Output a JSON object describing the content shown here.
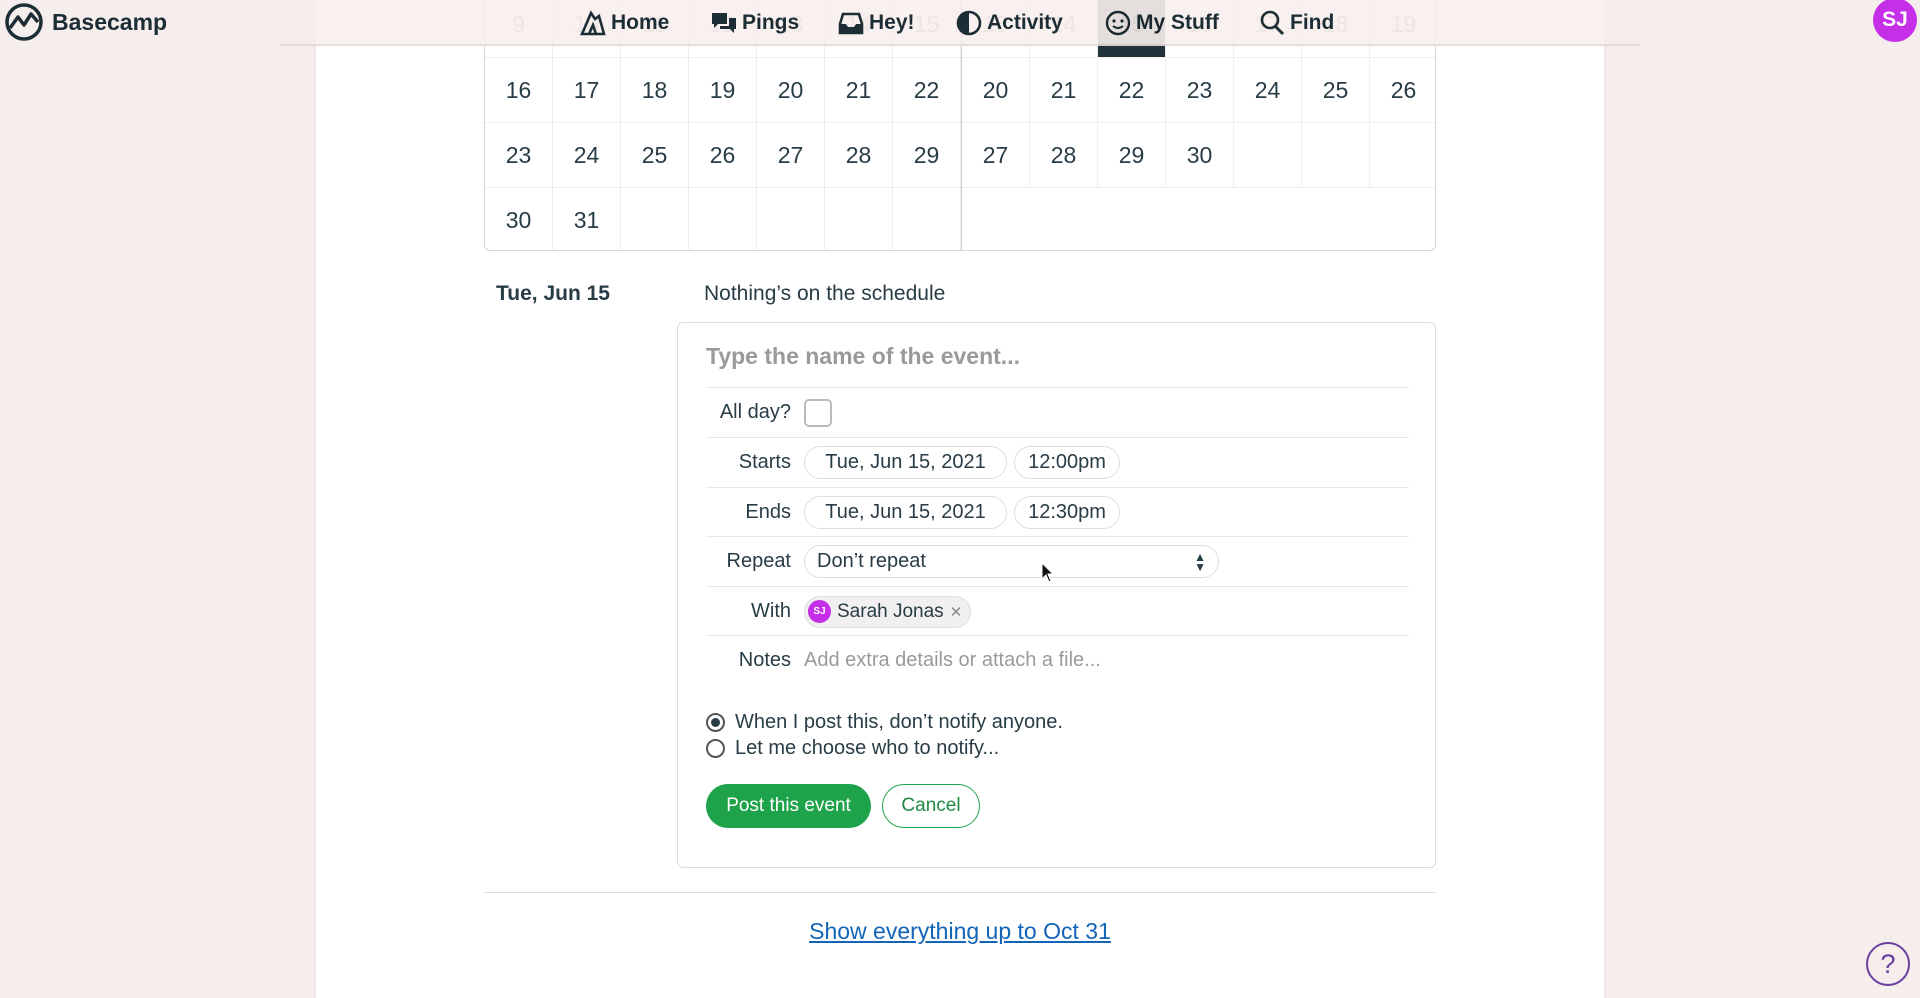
{
  "nav": {
    "logo": "Basecamp",
    "items": [
      {
        "label": "Home",
        "icon": "home-icon"
      },
      {
        "label": "Pings",
        "icon": "pings-icon"
      },
      {
        "label": "Hey!",
        "icon": "hey-icon"
      },
      {
        "label": "Activity",
        "icon": "activity-icon"
      },
      {
        "label": "My Stuff",
        "icon": "smiley-icon"
      },
      {
        "label": "Find",
        "icon": "search-icon"
      }
    ],
    "avatar": "SJ"
  },
  "calendar": {
    "left_rows": [
      [
        "9",
        "10",
        "11",
        "12",
        "13",
        "14",
        "15"
      ],
      [
        "16",
        "17",
        "18",
        "19",
        "20",
        "21",
        "22"
      ],
      [
        "23",
        "24",
        "25",
        "26",
        "27",
        "28",
        "29"
      ],
      [
        "30",
        "31",
        "",
        "",
        "",
        "",
        ""
      ]
    ],
    "right_rows": [
      [
        "13",
        "14",
        "15",
        "16",
        "17",
        "18",
        "19"
      ],
      [
        "20",
        "21",
        "22",
        "23",
        "24",
        "25",
        "26"
      ],
      [
        "27",
        "28",
        "29",
        "30",
        "",
        "",
        ""
      ],
      [
        "",
        "",
        "",
        "",
        "",
        "",
        ""
      ]
    ]
  },
  "day": {
    "label": "Tue, Jun 15",
    "empty": "Nothing’s on the schedule"
  },
  "form": {
    "title_placeholder": "Type the name of the event...",
    "allday_label": "All day?",
    "starts_label": "Starts",
    "start_date": "Tue, Jun 15, 2021",
    "start_time": "12:00pm",
    "ends_label": "Ends",
    "end_date": "Tue, Jun 15, 2021",
    "end_time": "12:30pm",
    "repeat_label": "Repeat",
    "repeat_value": "Don’t repeat",
    "with_label": "With",
    "with_person": "Sarah Jonas",
    "with_initials": "SJ",
    "notes_label": "Notes",
    "notes_placeholder": "Add extra details or attach a file...",
    "radio1": "When I post this, don’t notify anyone.",
    "radio2": "Let me choose who to notify...",
    "post": "Post this event",
    "cancel": "Cancel"
  },
  "show_link": "Show everything up to Oct 31",
  "help": "?",
  "colors": {
    "accent": "#1fa34a",
    "avatar": "#c62fe8",
    "link": "#1264b7"
  }
}
